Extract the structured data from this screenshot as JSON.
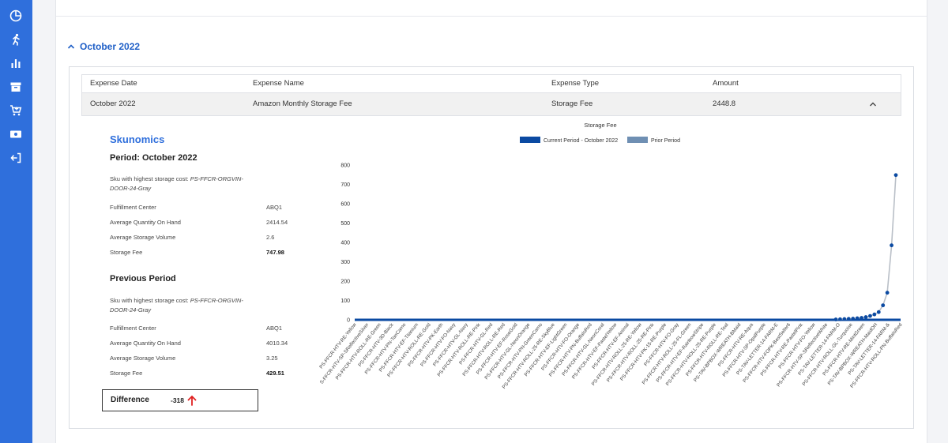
{
  "sidebar": {
    "icons": [
      "dashboard-icon",
      "running-person-icon",
      "bar-chart-icon",
      "archive-icon",
      "cart-add-icon",
      "cash-icon",
      "logout-icon"
    ],
    "color": "#2f6fdc"
  },
  "section": {
    "month_label": "October 2022"
  },
  "table": {
    "headers": [
      "Expense Date",
      "Expense Name",
      "Expense Type",
      "Amount"
    ],
    "row": {
      "date": "October 2022",
      "name": "Amazon Monthly Storage Fee",
      "type": "Storage Fee",
      "amount": "2448.8"
    }
  },
  "details": {
    "brand": "Skunomics",
    "current": {
      "heading": "Period: October 2022",
      "sku_label": "Sku with highest storage cost:",
      "sku_value": "PS-FFCR-ORGVIN-DOOR-24-Gray",
      "fields": [
        {
          "label": "Fulfillment Center",
          "value": "ABQ1"
        },
        {
          "label": "Average Quantity On Hand",
          "value": "2414.54"
        },
        {
          "label": "Average Storage Volume",
          "value": "2.6"
        },
        {
          "label": "Storage Fee",
          "value": "747.98"
        }
      ]
    },
    "previous": {
      "heading": "Previous Period",
      "sku_label": "Sku with highest storage cost:",
      "sku_value": "PS-FFCR-ORGVIN-DOOR-24-Gray",
      "fields": [
        {
          "label": "Fulfillment Center",
          "value": "ABQ1"
        },
        {
          "label": "Average Quantity On Hand",
          "value": "4010.34"
        },
        {
          "label": "Average Storage Volume",
          "value": "3.25"
        },
        {
          "label": "Storage Fee",
          "value": "429.51"
        }
      ]
    },
    "difference": {
      "label": "Difference",
      "value": "-318",
      "arrow_color": "#e02020"
    }
  },
  "chart_data": {
    "type": "line",
    "title": "Storage Fee",
    "ylim": [
      0,
      800
    ],
    "yticks": [
      0,
      100,
      200,
      300,
      400,
      500,
      600,
      700,
      800
    ],
    "legend_position": "top",
    "series": [
      {
        "name": "Current Period - October 2022",
        "color": "#0b4aa2",
        "tail": [
          2,
          3,
          4,
          5,
          6,
          8,
          10,
          14,
          20,
          28,
          40,
          75,
          140,
          385,
          748
        ]
      },
      {
        "name": "Prior Period",
        "color": "#6f8fb3",
        "tail": []
      }
    ],
    "x": [
      "PS-FFCR-HTV-RE-Yellow",
      "S-FFCR-HTV-SP-SReflectiveSilver",
      "PS-FFCR-HTV-ROLL-RE-Green",
      "PS-FFCR-HTV-3D-Black",
      "PS-FFCR-HTV-PN-TanCamo",
      "PS-FFCR-HTV-EF-Titanium",
      "PS-FFCR-HTV-ROLL-RE-Gold",
      "PS-FFCR-HTV-PK-Earth",
      "PS-FFCR-HTV-FO-Navy",
      "PS-FFCR-HTV-GL-Navy",
      "PS-FFCR-HTV-ROLL-RE-Pink",
      "PS-FFCR-HTV-GL-Red",
      "PS-FFCR-HTV-ROLL-RE-Red",
      "PS-FFCR-HTV-EF-RoseGold",
      "PS-FFCR-HTV-GL-NeonOrange",
      "PS-FFCR-HTV-PN-GreenCamo",
      "PS-FFCR-HTV-ROLL-25-RE-SkyBlue",
      "PS-FFCR-HTV-EF-LightGreen",
      "PS-FFCR-HTV-FO-Orange",
      "PS-FFCR-HTV-PN-BuffaloRed",
      "PS-FFCR-HTV-GL-NeonCoral",
      "PS-FFCR-HTV-EF-PastelYellow",
      "PS-FFCR-HTV-EF-Animal",
      "PS-FFCR-HTV-ROLL-25-RE-Yellow",
      "PS-FFCR-HTV-ROLL-25-RE-Pink",
      "PS-FFCR-HTV-PK-15-RE-Purple",
      "PS-FFCR-HTV-FO-Gray",
      "PS-FFCR-HTV-ROLL-25-FL-Green",
      "PS-FFCR-HTV-EF-RainbowStripe",
      "PS-FFCR-HTV-ROLL-25-RE-Purple",
      "PS-FFCR-HTV-ROLL-RE-Teal",
      "PS-TAV-BPBOX-WREATH-BMaid",
      "PS-FFCR-HTV-RE-Aqua",
      "PS-FFCR-HTV-SP-OpalPurple",
      "PS-TAV-LETTER-14-FARM-E",
      "PS-FFCR-HTV-FOPK-BestSeller6",
      "PS-FFCR-HTV-RE-PastelPink",
      "PS-FFCR-HTV-FO-Yellow",
      "PS-FFCR-HTV-SP-SReflectiveWhite",
      "PS-TAV-LETTER-14-FARM-O",
      "PS-FFCR-HTV-ROLL-GL-Turquoise",
      "PS-FFCR-HTV-RE-MintGreen",
      "PS-TAV-BPBOX-WREATH-MaidOH",
      "PS-TAV-LETTER-14-FARM-&",
      "PS-FFCR-HTV-ROLL-PN-BuffaloRed"
    ]
  }
}
